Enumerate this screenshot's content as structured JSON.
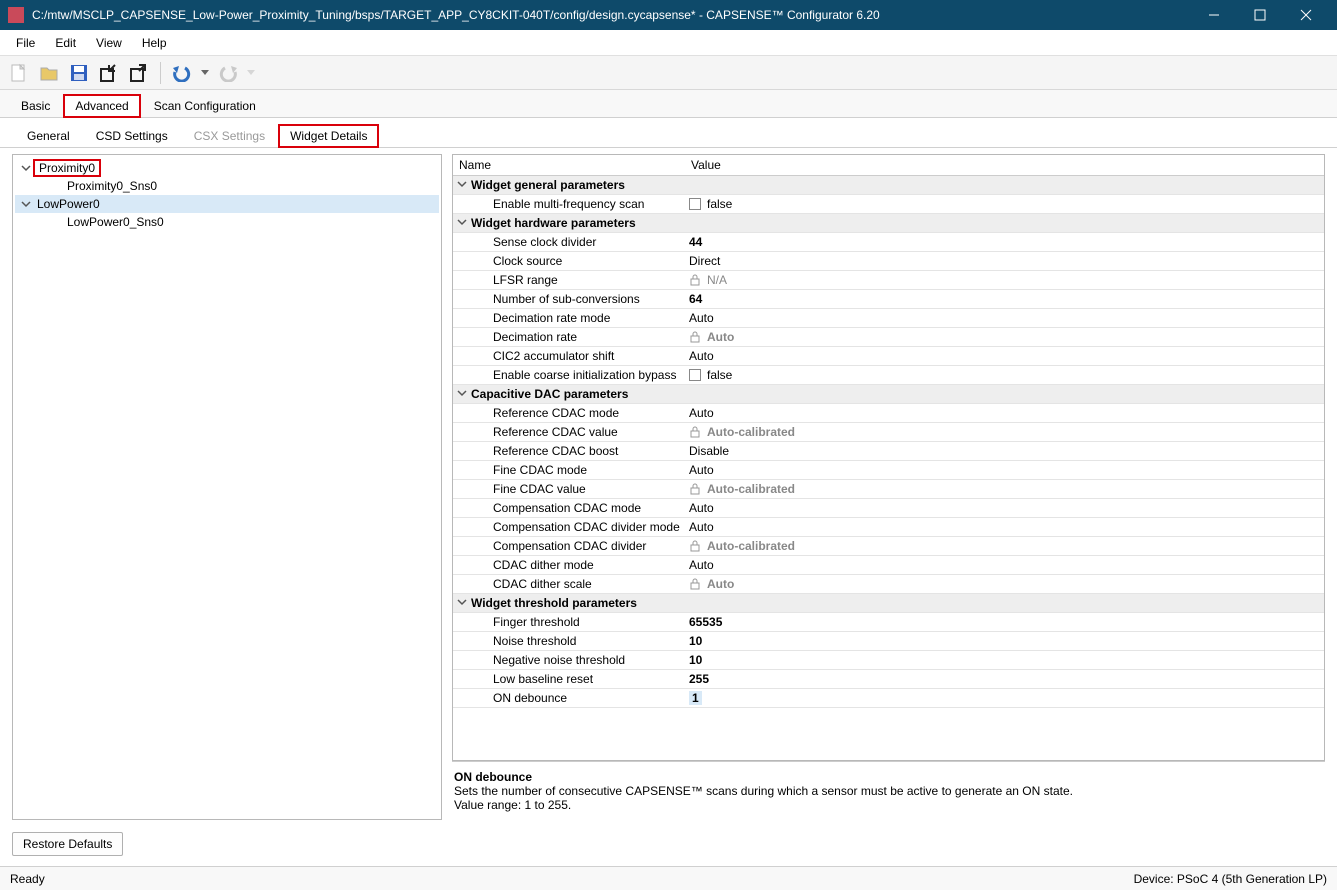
{
  "window": {
    "title": "C:/mtw/MSCLP_CAPSENSE_Low-Power_Proximity_Tuning/bsps/TARGET_APP_CY8CKIT-040T/config/design.cycapsense* - CAPSENSE™ Configurator 6.20"
  },
  "menu": {
    "file": "File",
    "edit": "Edit",
    "view": "View",
    "help": "Help"
  },
  "maintabs": {
    "basic": "Basic",
    "advanced": "Advanced",
    "scanconf": "Scan Configuration"
  },
  "subtabs": {
    "general": "General",
    "csd": "CSD Settings",
    "csx": "CSX Settings",
    "widget": "Widget Details"
  },
  "tree": {
    "n0": "Proximity0",
    "n0c0": "Proximity0_Sns0",
    "n1": "LowPower0",
    "n1c0": "LowPower0_Sns0"
  },
  "gridheader": {
    "name": "Name",
    "value": "Value"
  },
  "groups": {
    "g1": "Widget general parameters",
    "g2": "Widget hardware parameters",
    "g3": "Capacitive DAC parameters",
    "g4": "Widget threshold parameters"
  },
  "params": {
    "multi_freq": "Enable multi-frequency scan",
    "sense_clk_div": "Sense clock divider",
    "clock_src": "Clock source",
    "lfsr": "LFSR range",
    "subconv": "Number of sub-conversions",
    "dec_mode": "Decimation rate mode",
    "dec_rate": "Decimation rate",
    "cic2": "CIC2 accumulator shift",
    "coarse_init": "Enable coarse initialization bypass",
    "ref_cdac_mode": "Reference CDAC mode",
    "ref_cdac_val": "Reference CDAC value",
    "ref_cdac_boost": "Reference CDAC boost",
    "fine_cdac_mode": "Fine CDAC mode",
    "fine_cdac_val": "Fine CDAC value",
    "comp_cdac_mode": "Compensation CDAC mode",
    "comp_cdac_div_mode": "Compensation CDAC divider mode",
    "comp_cdac_div": "Compensation CDAC divider",
    "dither_mode": "CDAC dither mode",
    "dither_scale": "CDAC dither scale",
    "finger_thr": "Finger threshold",
    "noise_thr": "Noise threshold",
    "neg_noise_thr": "Negative noise threshold",
    "low_base": "Low baseline reset",
    "on_deb": "ON debounce"
  },
  "values": {
    "false": "false",
    "sense_clk_div": "44",
    "clock_src": "Direct",
    "lfsr": "N/A",
    "subconv": "64",
    "auto": "Auto",
    "autocalib": "Auto-calibrated",
    "disable": "Disable",
    "finger_thr": "65535",
    "noise_thr": "10",
    "neg_noise_thr": "10",
    "low_base": "255",
    "on_deb": "1"
  },
  "info": {
    "title": "ON debounce",
    "line1": "Sets the number of consecutive CAPSENSE™ scans during which a sensor must be active to generate an ON state.",
    "line2": "Value range: 1 to 255."
  },
  "restore": "Restore Defaults",
  "status": {
    "ready": "Ready",
    "device": "Device: PSoC 4 (5th Generation LP)"
  }
}
